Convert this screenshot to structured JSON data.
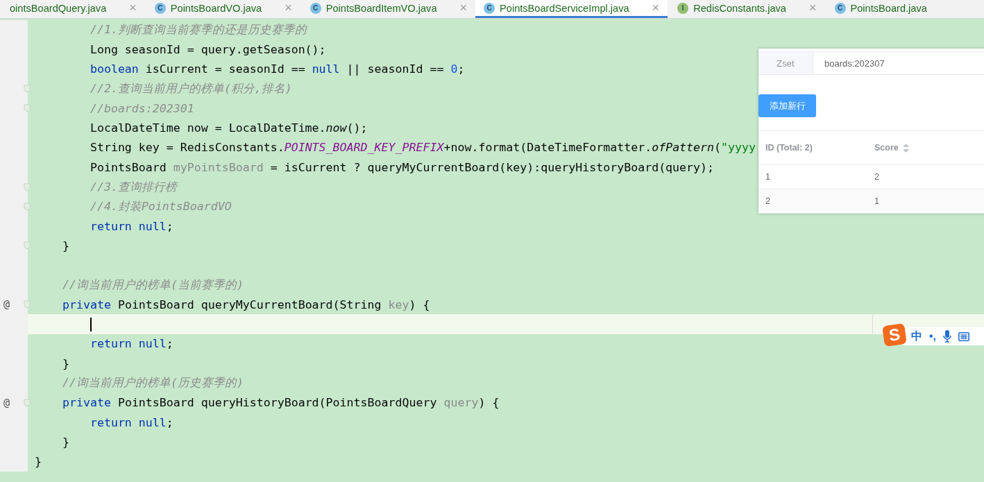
{
  "tabs": [
    {
      "label": "ointsBoardQuery.java",
      "selected": false,
      "close": "×"
    },
    {
      "label": "PointsBoardVO.java",
      "kind": "class",
      "icon_letter": "C",
      "selected": false,
      "close": "×"
    },
    {
      "label": "PointsBoardItemVO.java",
      "kind": "class",
      "icon_letter": "C",
      "selected": false,
      "close": "×"
    },
    {
      "label": "PointsBoardServiceImpl.java",
      "kind": "class",
      "icon_letter": "C",
      "selected": true,
      "close": "×"
    },
    {
      "label": "RedisConstants.java",
      "kind": "interface",
      "icon_letter": "I",
      "selected": false,
      "close": "×"
    },
    {
      "label": "PointsBoard.java",
      "kind": "class",
      "icon_letter": "C",
      "selected": false
    }
  ],
  "editor": {
    "lines": [
      {
        "fold": false,
        "current": false,
        "tokens": [
          {
            "kind": "comment",
            "t": "        //1.判断查询当前赛季的还是历史赛季的"
          }
        ]
      },
      {
        "fold": false,
        "current": false,
        "tokens": [
          {
            "kind": "plain",
            "t": "        Long seasonId = query.getSeason();"
          }
        ]
      },
      {
        "fold": false,
        "current": false,
        "tokens": [
          {
            "kind": "kw",
            "t": "        boolean"
          },
          {
            "kind": "plain",
            "t": " isCurrent = seasonId == "
          },
          {
            "kind": "kw",
            "t": "null"
          },
          {
            "kind": "plain",
            "t": " || seasonId == "
          },
          {
            "kind": "num",
            "t": "0"
          },
          {
            "kind": "plain",
            "t": ";"
          }
        ]
      },
      {
        "fold": true,
        "current": false,
        "tokens": [
          {
            "kind": "comment",
            "t": "        //2.查询当前用户的榜单(积分,排名)"
          }
        ]
      },
      {
        "fold": true,
        "current": false,
        "tokens": [
          {
            "kind": "comment",
            "t": "        //boards:202301"
          }
        ]
      },
      {
        "fold": false,
        "current": false,
        "tokens": [
          {
            "kind": "plain",
            "t": "        LocalDateTime now = LocalDateTime."
          },
          {
            "kind": "italic",
            "t": "now"
          },
          {
            "kind": "plain",
            "t": "();"
          }
        ]
      },
      {
        "fold": false,
        "current": false,
        "tokens": [
          {
            "kind": "plain",
            "t": "        String key = RedisConstants."
          },
          {
            "kind": "const",
            "t": "POINTS_BOARD_KEY_PREFIX"
          },
          {
            "kind": "plain",
            "t": "+now.format(DateTimeFormatter."
          },
          {
            "kind": "italic",
            "t": "ofPattern"
          },
          {
            "kind": "plain",
            "t": "("
          },
          {
            "kind": "str",
            "t": "\"yyyy"
          }
        ]
      },
      {
        "fold": false,
        "current": false,
        "tokens": [
          {
            "kind": "plain",
            "t": "        PointsBoard "
          },
          {
            "kind": "dim",
            "t": "myPointsBoard"
          },
          {
            "kind": "plain",
            "t": " = isCurrent ? queryMyCurrentBoard(key):queryHistoryBoard(query);"
          }
        ]
      },
      {
        "fold": true,
        "current": false,
        "tokens": [
          {
            "kind": "comment",
            "t": "        //3.查询排行榜"
          }
        ]
      },
      {
        "fold": true,
        "current": false,
        "tokens": [
          {
            "kind": "comment",
            "t": "        //4.封装PointsBoardVO"
          }
        ]
      },
      {
        "fold": false,
        "current": false,
        "tokens": [
          {
            "kind": "kw",
            "t": "        return null"
          },
          {
            "kind": "plain",
            "t": ";"
          }
        ]
      },
      {
        "fold": true,
        "current": false,
        "tokens": [
          {
            "kind": "plain",
            "t": "    }"
          }
        ]
      },
      {
        "fold": false,
        "current": false
      },
      {
        "fold": false,
        "current": false,
        "tokens": [
          {
            "kind": "comment",
            "t": "    //询当前用户的榜单(当前赛季的)"
          }
        ]
      },
      {
        "fold": true,
        "current": false,
        "gutter": "@",
        "tokens": [
          {
            "kind": "kw",
            "t": "    private"
          },
          {
            "kind": "plain",
            "t": " PointsBoard queryMyCurrentBoard(String "
          },
          {
            "kind": "dim",
            "t": "key"
          },
          {
            "kind": "plain",
            "t": ") {"
          }
        ]
      },
      {
        "fold": false,
        "current": true
      },
      {
        "fold": false,
        "current": false,
        "tokens": [
          {
            "kind": "kw",
            "t": "        return null"
          },
          {
            "kind": "plain",
            "t": ";"
          }
        ]
      },
      {
        "fold": false,
        "current": false,
        "tokens": [
          {
            "kind": "plain",
            "t": "    }"
          }
        ]
      },
      {
        "fold": false,
        "current": false,
        "tokens": [
          {
            "kind": "comment",
            "t": "    //询当前用户的榜单(历史赛季的)"
          }
        ]
      },
      {
        "fold": true,
        "current": false,
        "gutter": "@",
        "tokens": [
          {
            "kind": "kw",
            "t": "    private"
          },
          {
            "kind": "plain",
            "t": " PointsBoard queryHistoryBoard(PointsBoardQuery "
          },
          {
            "kind": "dim",
            "t": "query"
          },
          {
            "kind": "plain",
            "t": ") {"
          }
        ]
      },
      {
        "fold": false,
        "current": false,
        "tokens": [
          {
            "kind": "kw",
            "t": "        return null"
          },
          {
            "kind": "plain",
            "t": ";"
          }
        ]
      },
      {
        "fold": false,
        "current": false,
        "tokens": [
          {
            "kind": "plain",
            "t": "    }"
          }
        ]
      },
      {
        "fold": false,
        "current": false,
        "tokens": [
          {
            "kind": "plain",
            "t": "}"
          }
        ]
      }
    ]
  },
  "redis_panel": {
    "type_label": "Zset",
    "key": "boards:202307",
    "add_button": "添加新行",
    "columns": [
      {
        "label": "ID (Total: 2)",
        "sortable": false
      },
      {
        "label": "Score",
        "sortable": true
      }
    ],
    "rows": [
      [
        "1",
        "2"
      ],
      [
        "2",
        "1"
      ]
    ]
  },
  "ime_toolbar": {
    "logo": "S",
    "mode": "中",
    "punctuation": "•,"
  }
}
